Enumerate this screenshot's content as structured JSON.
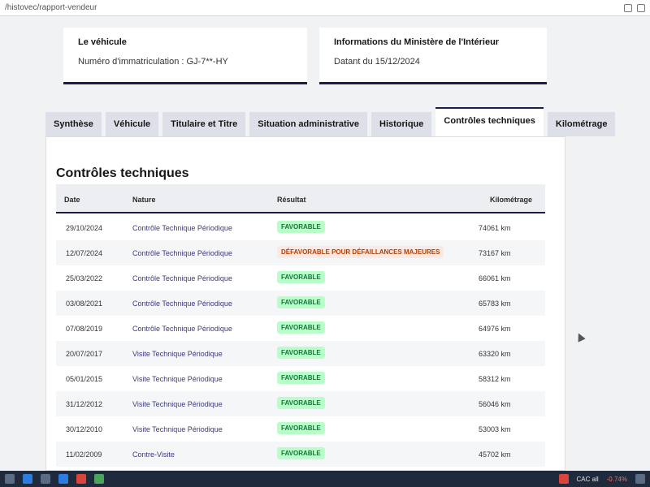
{
  "browser": {
    "url": "/histovec/rapport-vendeur"
  },
  "vehicle_card": {
    "title": "Le véhicule",
    "plate_line": "Numéro d'immatriculation : GJ-7**-HY"
  },
  "ministry_card": {
    "title": "Informations du Ministère de l'Intérieur",
    "date_line": "Datant du 15/12/2024"
  },
  "tabs": [
    {
      "label": "Synthèse",
      "active": false
    },
    {
      "label": "Véhicule",
      "active": false
    },
    {
      "label": "Titulaire et Titre",
      "active": false
    },
    {
      "label": "Situation administrative",
      "active": false
    },
    {
      "label": "Historique",
      "active": false
    },
    {
      "label": "Contrôles techniques",
      "active": true
    },
    {
      "label": "Kilométrage",
      "active": false
    }
  ],
  "section_title": "Contrôles techniques",
  "table": {
    "columns": [
      "Date",
      "Nature",
      "Résultat",
      "Kilométrage"
    ],
    "rows": [
      {
        "date": "29/10/2024",
        "nature": "Contrôle Technique Périodique",
        "result": "FAVORABLE",
        "km": "74061 km"
      },
      {
        "date": "12/07/2024",
        "nature": "Contrôle Technique Périodique",
        "result": "DÉFAVORABLE POUR DÉFAILLANCES MAJEURES",
        "km": "73167 km"
      },
      {
        "date": "25/03/2022",
        "nature": "Contrôle Technique Périodique",
        "result": "FAVORABLE",
        "km": "66061 km"
      },
      {
        "date": "03/08/2021",
        "nature": "Contrôle Technique Périodique",
        "result": "FAVORABLE",
        "km": "65783 km"
      },
      {
        "date": "07/08/2019",
        "nature": "Contrôle Technique Périodique",
        "result": "FAVORABLE",
        "km": "64976 km"
      },
      {
        "date": "20/07/2017",
        "nature": "Visite Technique Périodique",
        "result": "FAVORABLE",
        "km": "63320 km"
      },
      {
        "date": "05/01/2015",
        "nature": "Visite Technique Périodique",
        "result": "FAVORABLE",
        "km": "58312 km"
      },
      {
        "date": "31/12/2012",
        "nature": "Visite Technique Périodique",
        "result": "FAVORABLE",
        "km": "56046 km"
      },
      {
        "date": "30/12/2010",
        "nature": "Visite Technique Périodique",
        "result": "FAVORABLE",
        "km": "53003 km"
      },
      {
        "date": "11/02/2009",
        "nature": "Contre-Visite",
        "result": "FAVORABLE",
        "km": "45702 km"
      }
    ]
  },
  "taskbar": {
    "ticker": "CAC all",
    "change": "-0.74%"
  },
  "colors": {
    "accent": "#1c1d4f",
    "favorable_bg": "#b8fec9",
    "favorable_fg": "#18753c",
    "defavorable_fg": "#b34000"
  }
}
